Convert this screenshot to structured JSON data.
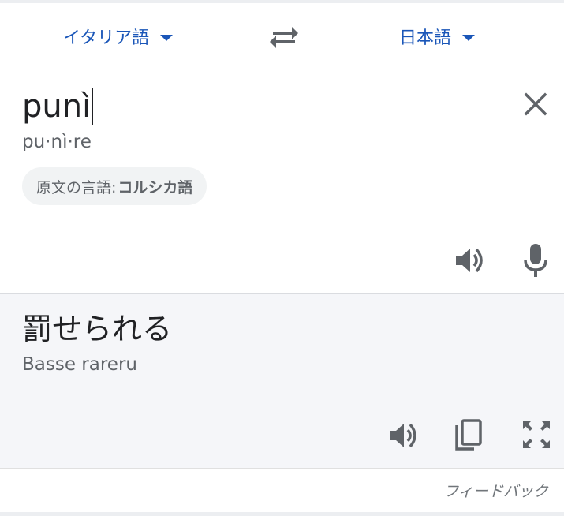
{
  "languages": {
    "source": "イタリア語",
    "target": "日本語",
    "accent_color": "#1a56b8"
  },
  "input": {
    "text": "punì",
    "pronunciation": "pu·nì·re",
    "detected_prefix": "原文の言語: ",
    "detected_language": "コルシカ語"
  },
  "result": {
    "text": "罰せられる",
    "romanization": "Basse rareru",
    "background": "#f5f6f9"
  },
  "footer": {
    "feedback": "フィードバック"
  },
  "icons": {
    "swap": "swap-horiz-icon",
    "clear": "close-icon",
    "speaker": "volume-up-icon",
    "mic": "mic-icon",
    "copy": "content-copy-icon",
    "expand": "fullscreen-icon"
  }
}
